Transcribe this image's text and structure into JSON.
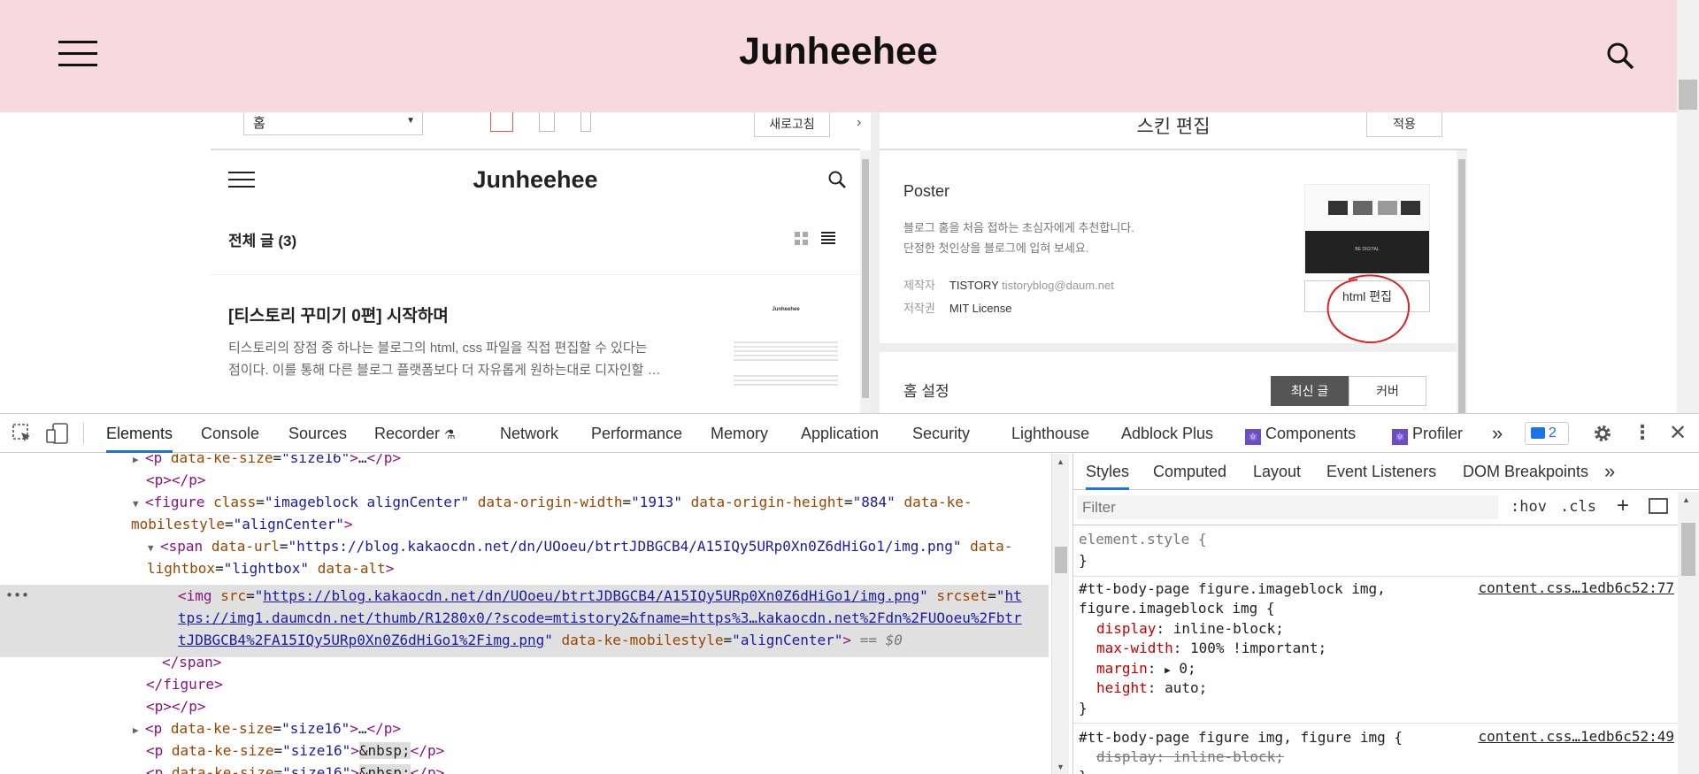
{
  "blog": {
    "title": "Junheehee"
  },
  "preview": {
    "select_value": "홈",
    "refresh_label": "새로고침",
    "title": "Junheehee",
    "count_label": "전체 글 (3)",
    "post_title": "[티스토리 꾸미기 0편] 시작하며",
    "post_excerpt_1": "티스토리의 장점 중 하나는 블로그의 html, css 파일을 직접 편집할 수 있다는",
    "post_excerpt_2": "점이다. 이를 통해 다른 블로그 플랫폼보다 더 자유롭게 원하는대로 디자인할 …",
    "thumb_title": "Junheehee"
  },
  "skin": {
    "header_title": "스킨 편집",
    "apply_label": "적용",
    "name": "Poster",
    "desc_1": "블로그 홈을 처음 접하는 초심자에게 추천합니다.",
    "desc_2": "단정한 첫인상을 블로그에 입혀 보세요.",
    "author_label": "제작자",
    "author_value": "TISTORY",
    "author_email": "tistoryblog@daum.net",
    "license_label": "저작권",
    "license_value": "MIT License",
    "thumb_text": "BE DIGITAL",
    "html_edit_label": "html 편집",
    "home_setting_label": "홈 설정",
    "tab_latest": "최신 글",
    "tab_cover": "커버"
  },
  "devtools": {
    "tabs": [
      "Elements",
      "Console",
      "Sources",
      "Recorder",
      "Network",
      "Performance",
      "Memory",
      "Application",
      "Security",
      "Lighthouse",
      "Adblock Plus",
      "Components",
      "Profiler"
    ],
    "issues_count": "2",
    "dom": {
      "l1_name": "p",
      "l1_attr": "data-ke-size",
      "l1_val": "size16",
      "l1_tail": "…",
      "l2": "p",
      "l3_name": "figure",
      "l3_a1": "class",
      "l3_v1": "imageblock alignCenter",
      "l3_a2": "data-origin-width",
      "l3_v2": "1913",
      "l3_a3": "data-origin-height",
      "l3_v3": "884",
      "l3_a4": "data-ke-",
      "l3_a4b": "mobilestyle",
      "l3_v4": "alignCenter",
      "l4_name": "span",
      "l4_a1": "data-url",
      "l4_v1": "https://blog.kakaocdn.net/dn/UOoeu/btrtJDBGCB4/A15IQy5URp0Xn0Z6dHiGo1/img.png",
      "l4_a2": "data-",
      "l4_a2b": "lightbox",
      "l4_v2": "lightbox",
      "l4_a3": "data-alt",
      "l5_name": "img",
      "l5_a1": "src",
      "l5_v1": "https://blog.kakaocdn.net/dn/UOoeu/btrtJDBGCB4/A15IQy5URp0Xn0Z6dHiGo1/img.png",
      "l5_a2": "srcset",
      "l5_v2a": "ht",
      "l5_v2b": "tps://img1.daumcdn.net/thumb/R1280x0/?scode=mtistory2&fname=https%3…kakaocdn.net%2Fdn%2FUOoeu%2Fbtr",
      "l5_v2c": "tJDBGCB4%2FA15IQy5URp0Xn0Z6dHiGo1%2Fimg.png",
      "l5_a3": "data-ke-mobilestyle",
      "l5_v3": "alignCenter",
      "l5_eq": "== $0",
      "l6": "span",
      "l7": "figure",
      "l8": "p",
      "l9_name": "p",
      "l9_attr": "data-ke-size",
      "l9_val": "size16",
      "l9_tail": "…",
      "l10_name": "p",
      "l10_attr": "data-ke-size",
      "l10_val": "size16",
      "l10_text": "&nbsp;",
      "l11_name": "p",
      "l11_attr": "data-ke-size",
      "l11_val": "size16",
      "l11_text": "&nbsp;"
    },
    "styles": {
      "tabs": [
        "Styles",
        "Computed",
        "Layout",
        "Event Listeners",
        "DOM Breakpoints"
      ],
      "filter_placeholder": "Filter",
      "hov": ":hov",
      "cls": ".cls",
      "rule0_sel": "element.style {",
      "close": "}",
      "rule1_sel1": "#tt-body-page figure.imageblock img,",
      "rule1_sel2": "figure.imageblock img {",
      "rule1_src": "content.css…1edb6c52:77",
      "rule1_p1": "display",
      "rule1_v1": "inline-block;",
      "rule1_p2": "max-width",
      "rule1_v2": "100% !important;",
      "rule1_p3": "margin",
      "rule1_v3": "0;",
      "rule1_p4": "height",
      "rule1_v4": "auto;",
      "rule2_sel": "#tt-body-page figure img, figure img {",
      "rule2_src": "content.css…1edb6c52:49",
      "rule2_p1": "display",
      "rule2_v1": "inline-block;"
    }
  }
}
